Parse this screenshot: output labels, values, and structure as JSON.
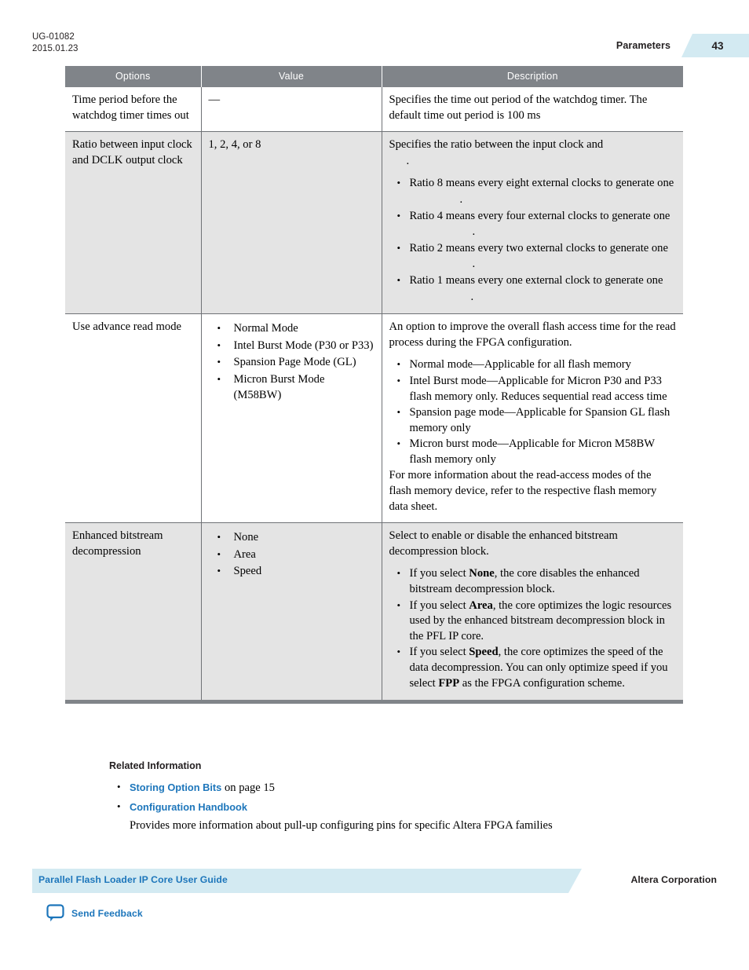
{
  "header": {
    "doc_id": "UG-01082",
    "doc_date": "2015.01.23",
    "chapter": "Parameters",
    "page_number": "43",
    "badge_color": "#d3eaf2"
  },
  "table": {
    "columns": [
      "Options",
      "Value",
      "Description"
    ],
    "header_bg": "#808489",
    "rows": [
      {
        "option": "Time period before the watchdog timer times out",
        "value": "—",
        "description": {
          "intro": "Specifies the time out period of the watchdog timer. The default time out period is 100 ms",
          "bullets": []
        }
      },
      {
        "option": "Ratio between input clock and DCLK output clock",
        "value": "1, 2, 4, or 8",
        "description": {
          "intro": "Specifies the ratio between the input clock and",
          "intro_code": "",
          "intro_suffix": ".",
          "bullets": [
            {
              "text": "Ratio 8 means every eight external clocks to generate one",
              "code": "",
              "suffix": "."
            },
            {
              "text": "Ratio 4 means every four external clocks to generate one",
              "code": "",
              "suffix": "."
            },
            {
              "text": "Ratio 2 means every two external clocks to generate one",
              "code": "",
              "suffix": "."
            },
            {
              "text": "Ratio 1 means every one external clock to generate one",
              "code": "",
              "suffix": "."
            }
          ]
        }
      },
      {
        "option": "Use advance read mode",
        "value_list": [
          "Normal Mode",
          "Intel Burst Mode (P30 or P33)",
          "Spansion Page Mode (GL)",
          "Micron Burst Mode (M58BW)"
        ],
        "description": {
          "intro": "An option to improve the overall flash access time for the read process during the FPGA configuration.",
          "bullets": [
            "Normal mode—Applicable for all flash memory",
            "Intel Burst mode—Applicable for Micron P30 and P33 flash memory only. Reduces sequential read access time",
            "Spansion page mode—Applicable for Spansion GL flash memory only",
            "Micron burst mode—Applicable for Micron M58BW flash memory only"
          ],
          "outro": "For more information about the read-access modes of the flash memory device, refer to the respective flash memory data sheet."
        }
      },
      {
        "option": "Enhanced bitstream decompression",
        "value_list": [
          "None",
          "Area",
          "Speed"
        ],
        "description": {
          "intro": "Select to enable or disable the enhanced bitstream decompression block.",
          "bullets_rich": [
            {
              "pre": "If you select ",
              "bold": "None",
              "post": ", the core disables the enhanced bitstream decompression block."
            },
            {
              "pre": "If you select ",
              "bold": "Area",
              "post": ", the core optimizes the logic resources used by the enhanced bitstream decompression block in the PFL IP core."
            },
            {
              "pre": "If you select ",
              "bold": "Speed",
              "post": ", the core optimizes the speed of the data decompression. You can only optimize speed if you select ",
              "bold2": "FPP",
              "post2": " as the FPGA configuration scheme."
            }
          ]
        }
      }
    ]
  },
  "related": {
    "title": "Related Information",
    "items": [
      {
        "link": "Storing Option Bits",
        "after": " on page 15",
        "sub": ""
      },
      {
        "link": "Configuration Handbook",
        "after": "",
        "sub": "Provides more information about pull-up configuring pins for specific Altera FPGA families"
      }
    ],
    "link_color": "#1d76bb"
  },
  "footer": {
    "guide_title": "Parallel Flash Loader IP Core User Guide",
    "corporation": "Altera Corporation",
    "feedback_label": "Send Feedback",
    "band_color": "#d3eaf2",
    "text_color": "#1d76bb"
  }
}
